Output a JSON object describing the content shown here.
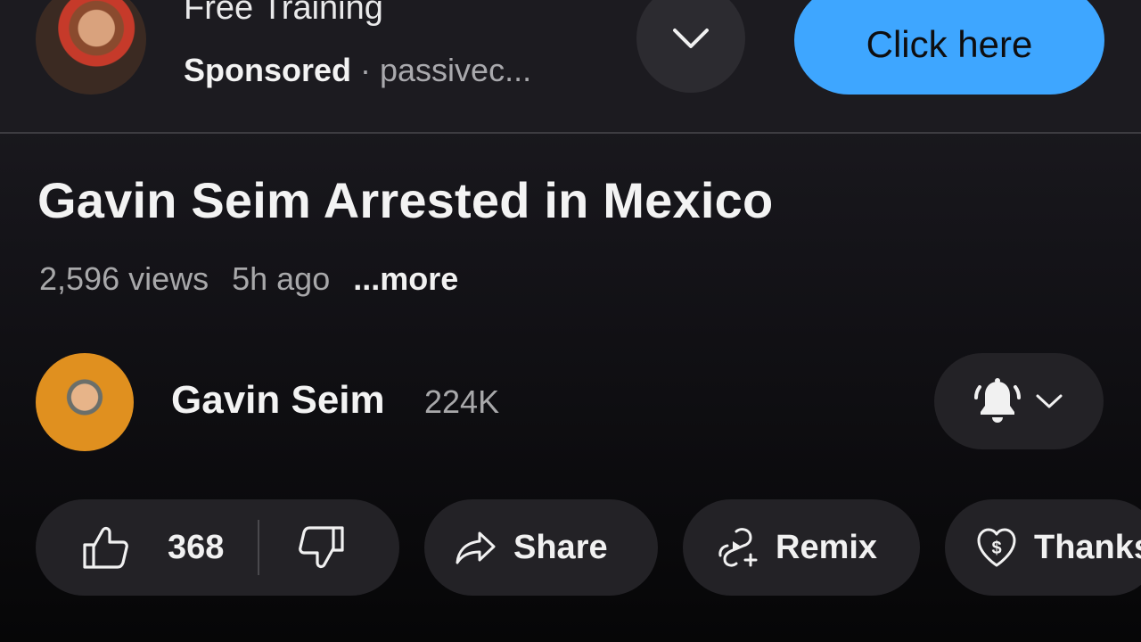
{
  "ad": {
    "title": "Free Training",
    "sponsored": "Sponsored",
    "separator": "·",
    "domain": "passivec...",
    "cta_label": "Click here",
    "accent_color": "#3ea6ff"
  },
  "video": {
    "title": "Gavin Seim Arrested in Mexico",
    "views": "2,596 views",
    "age": "5h ago",
    "more": "...more"
  },
  "channel": {
    "name": "Gavin Seim",
    "subscribers": "224K",
    "notification_icon": "bell-icon"
  },
  "actions": {
    "like_count": "368",
    "share": "Share",
    "remix": "Remix",
    "thanks": "Thanks"
  }
}
